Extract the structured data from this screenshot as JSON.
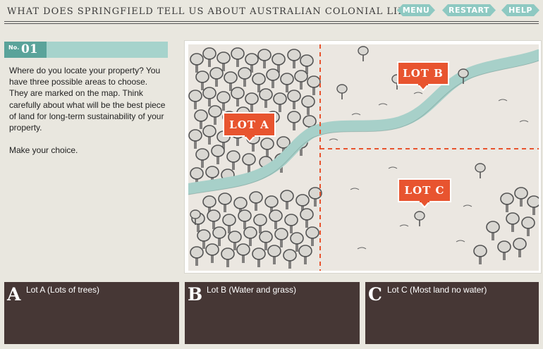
{
  "header": {
    "title": "WHAT DOES SPRINGFIELD TELL US ABOUT AUSTRALIAN COLONIAL LIFE?",
    "menu_label": "MENU",
    "restart_label": "RESTART",
    "help_label": "HELP"
  },
  "question": {
    "number_prefix": "No.",
    "number": "01",
    "text": "Where do you locate your property? You have three possible areas to choose. They are marked on the map. Think carefully about what will be the best piece of land for long-term sustainability of your property.\n\nMake your choice."
  },
  "map": {
    "lot_a": "LOT A",
    "lot_b": "LOT B",
    "lot_c": "LOT C",
    "colors": {
      "river": "#a7d0c9",
      "marker": "#e8542f",
      "boundary": "#e8542f"
    }
  },
  "answers": [
    {
      "letter": "A",
      "label": "Lot A (Lots of trees)"
    },
    {
      "letter": "B",
      "label": "Lot B (Water and grass)"
    },
    {
      "letter": "C",
      "label": "Lot C (Most land no water)"
    }
  ]
}
